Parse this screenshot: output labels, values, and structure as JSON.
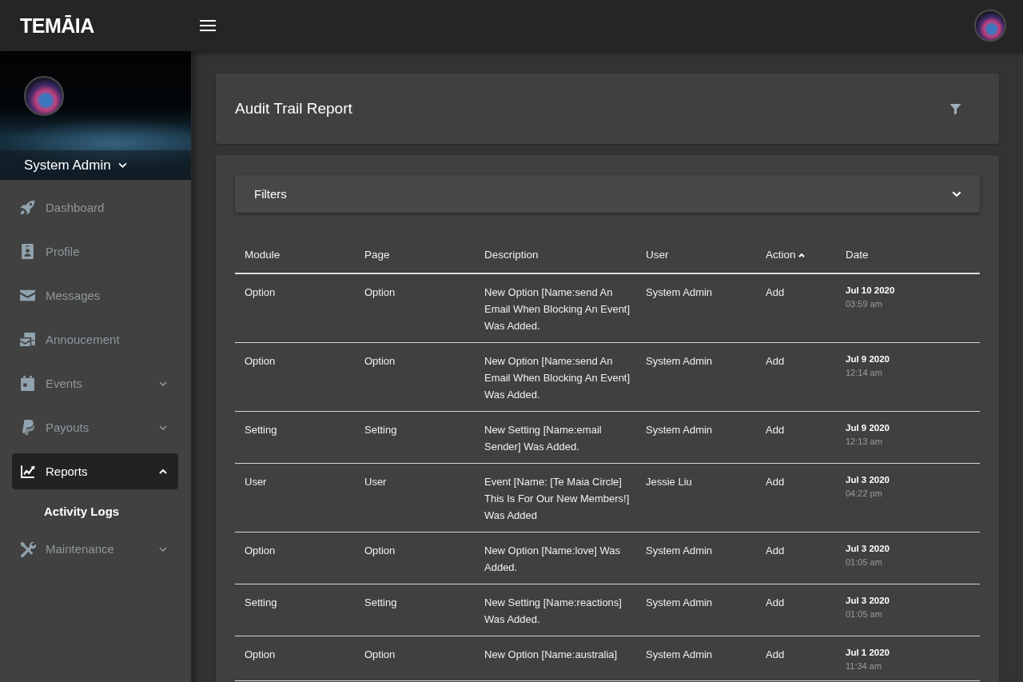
{
  "top_bar": {
    "logo": "TEMĀIA"
  },
  "sidebar": {
    "user_name": "System Admin",
    "items": [
      {
        "label": "Dashboard",
        "selected": false
      },
      {
        "label": "Profile",
        "selected": false
      },
      {
        "label": "Messages",
        "selected": false
      },
      {
        "label": "Annoucement",
        "selected": false
      },
      {
        "label": "Events",
        "selected": false,
        "expanded": false
      },
      {
        "label": "Payouts",
        "selected": false,
        "expanded": false
      },
      {
        "label": "Reports",
        "selected": true,
        "expanded": true,
        "children": [
          {
            "label": "Activity Logs",
            "selected": true
          }
        ]
      },
      {
        "label": "Maintenance",
        "selected": false,
        "expanded": false
      }
    ]
  },
  "page_header": {
    "title": "Audit Trail Report"
  },
  "filters": {
    "title": "Filters",
    "expanded": false
  },
  "table": {
    "columns": [
      {
        "label": "Module"
      },
      {
        "label": "Page"
      },
      {
        "label": "Description"
      },
      {
        "label": "User"
      },
      {
        "label": "Action",
        "sort_ascending": true
      },
      {
        "label": "Date"
      }
    ],
    "rows": [
      {
        "module": "Option",
        "page": "Option",
        "description": "New Option [Name:send An Email When Blocking An Event] Was Added.",
        "user": "System Admin",
        "action": "Add",
        "date": "Jul 10 2020",
        "time": "03:59 am"
      },
      {
        "module": "Option",
        "page": "Option",
        "description": "New Option [Name:send An Email When Blocking An Event] Was Added.",
        "user": "System Admin",
        "action": "Add",
        "date": "Jul 9 2020",
        "time": "12:14 am"
      },
      {
        "module": "Setting",
        "page": "Setting",
        "description": "New Setting [Name:email Sender] Was Added.",
        "user": "System Admin",
        "action": "Add",
        "date": "Jul 9 2020",
        "time": "12:13 am"
      },
      {
        "module": "User",
        "page": "User",
        "description": "Event [Name: [Te Maia Circle] This Is For Our New Members!] Was Added",
        "user": "Jessie Liu",
        "action": "Add",
        "date": "Jul 3 2020",
        "time": "04:22 pm"
      },
      {
        "module": "Option",
        "page": "Option",
        "description": "New Option [Name:love] Was Added.",
        "user": "System Admin",
        "action": "Add",
        "date": "Jul 3 2020",
        "time": "01:05 am"
      },
      {
        "module": "Setting",
        "page": "Setting",
        "description": "New Setting [Name:reactions] Was Added.",
        "user": "System Admin",
        "action": "Add",
        "date": "Jul 3 2020",
        "time": "01:05 am"
      },
      {
        "module": "Option",
        "page": "Option",
        "description": "New Option [Name:australia]",
        "user": "System Admin",
        "action": "Add",
        "date": "Jul 1 2020",
        "time": "11:34 am"
      }
    ]
  }
}
